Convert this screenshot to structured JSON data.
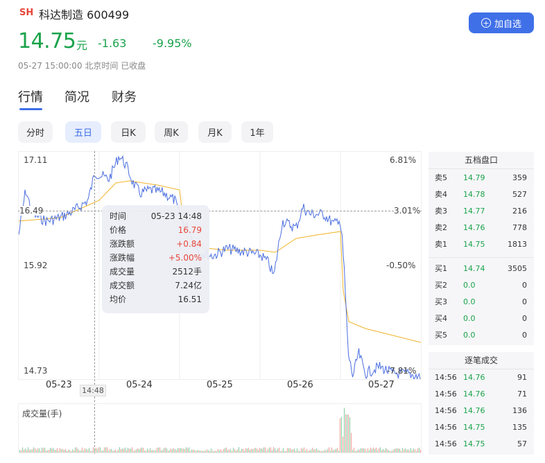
{
  "stock": {
    "market": "SH",
    "name_code": "科达制造 600499",
    "price": "14.75",
    "unit": "元",
    "change": "-1.63",
    "change_pct": "-9.95%",
    "time_status": "05-27 15:00:00 北京时间 已收盘"
  },
  "add_button": "加自选",
  "tabs": [
    "行情",
    "简况",
    "财务"
  ],
  "periods": [
    "分时",
    "五日",
    "日K",
    "周K",
    "月K",
    "1年"
  ],
  "chart": {
    "y_left": [
      "17.11",
      "16.49",
      "15.92",
      "14.73"
    ],
    "y_right": [
      "6.81%",
      "3.01%",
      "-0.50%",
      "-7.81%"
    ],
    "x_labels": [
      "05-23",
      "05-24",
      "05-25",
      "05-26",
      "05-27"
    ],
    "cursor_time": "14:48",
    "volume_label": "成交量(手)",
    "colors": {
      "price_line": "#4a6ee0",
      "avg_line": "#f0b429",
      "up": "#e8463b",
      "down": "#1aa34a"
    }
  },
  "tooltip": [
    {
      "k": "时间",
      "v": "05-23 14:48"
    },
    {
      "k": "价格",
      "v": "16.79"
    },
    {
      "k": "涨跌额",
      "v": "+0.84"
    },
    {
      "k": "涨跌幅",
      "v": "+5.00%"
    },
    {
      "k": "成交量",
      "v": "2512手"
    },
    {
      "k": "成交额",
      "v": "7.24亿"
    },
    {
      "k": "均价",
      "v": "16.51"
    }
  ],
  "orderbook": {
    "title": "五档盘口",
    "asks": [
      {
        "label": "卖5",
        "price": "14.79",
        "vol": "359"
      },
      {
        "label": "卖4",
        "price": "14.78",
        "vol": "527"
      },
      {
        "label": "卖3",
        "price": "14.77",
        "vol": "216"
      },
      {
        "label": "卖2",
        "price": "14.76",
        "vol": "778"
      },
      {
        "label": "卖1",
        "price": "14.75",
        "vol": "1813"
      }
    ],
    "bids": [
      {
        "label": "买1",
        "price": "14.74",
        "vol": "3505"
      },
      {
        "label": "买2",
        "price": "0.0",
        "vol": "0"
      },
      {
        "label": "买3",
        "price": "0.0",
        "vol": "0"
      },
      {
        "label": "买4",
        "price": "0.0",
        "vol": "0"
      },
      {
        "label": "买5",
        "price": "0.0",
        "vol": "0"
      }
    ]
  },
  "trades": {
    "title": "逐笔成交",
    "rows": [
      {
        "time": "14:56",
        "price": "14.76",
        "vol": "91"
      },
      {
        "time": "14:56",
        "price": "14.76",
        "vol": "71"
      },
      {
        "time": "14:56",
        "price": "14.76",
        "vol": "136"
      },
      {
        "time": "14:56",
        "price": "14.75",
        "vol": "135"
      },
      {
        "time": "14:56",
        "price": "14.75",
        "vol": "57"
      }
    ]
  }
}
